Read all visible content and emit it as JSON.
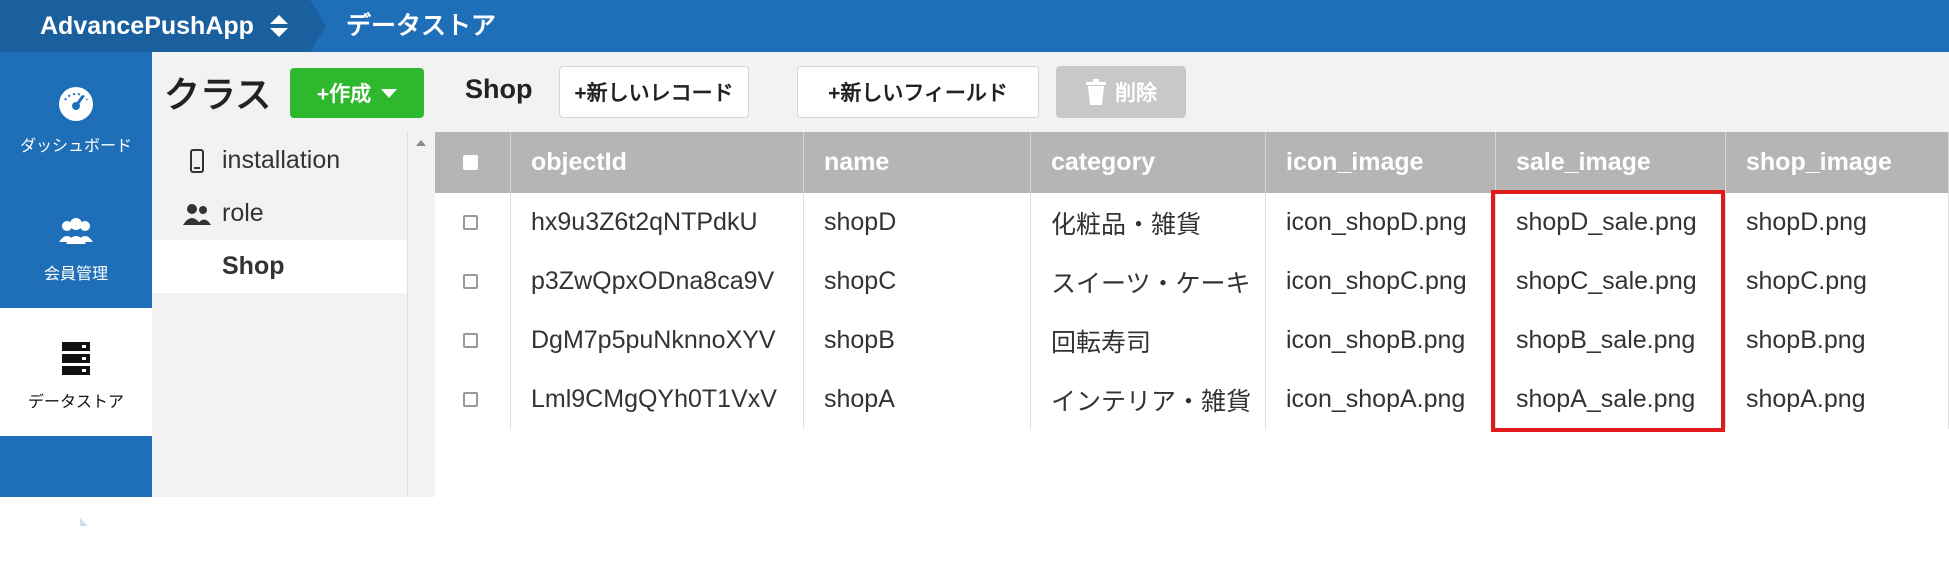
{
  "topbar": {
    "app_name": "AdvancePushApp",
    "breadcrumb": "データストア"
  },
  "nav": {
    "items": [
      {
        "label": "ダッシュボード",
        "icon": "gauge-icon"
      },
      {
        "label": "会員管理",
        "icon": "users-icon"
      },
      {
        "label": "データストア",
        "icon": "database-icon"
      },
      {
        "label": "",
        "icon": "file-icon"
      }
    ],
    "active": "データストア"
  },
  "classes": {
    "title": "クラス",
    "create_label": "+作成",
    "items": [
      {
        "label": "installation",
        "icon": "mobile-icon"
      },
      {
        "label": "role",
        "icon": "users-icon"
      },
      {
        "label": "Shop",
        "icon": ""
      }
    ],
    "selected": "Shop"
  },
  "toolbar": {
    "class_name": "Shop",
    "new_record_label": "+新しいレコード",
    "new_field_label": "+新しいフィールド",
    "delete_label": "削除"
  },
  "table": {
    "columns": [
      "objectId",
      "name",
      "category",
      "icon_image",
      "sale_image",
      "shop_image"
    ],
    "rows": [
      [
        "hx9u3Z6t2qNTPdkU",
        "shopD",
        "化粧品・雑貨",
        "icon_shopD.png",
        "shopD_sale.png",
        "shopD.png"
      ],
      [
        "p3ZwQpxODna8ca9V",
        "shopC",
        "スイーツ・ケーキ",
        "icon_shopC.png",
        "shopC_sale.png",
        "shopC.png"
      ],
      [
        "DgM7p5puNknnoXYV",
        "shopB",
        "回転寿司",
        "icon_shopB.png",
        "shopB_sale.png",
        "shopB.png"
      ],
      [
        "Lml9CMgQYh0T1VxV",
        "shopA",
        "インテリア・雑貨",
        "icon_shopA.png",
        "shopA_sale.png",
        "shopA.png"
      ]
    ],
    "highlighted_column": "sale_image"
  },
  "colors": {
    "primary": "#1e6fb8",
    "primary_dark": "#1a5f9e",
    "create_green": "#2db82d",
    "header_gray": "#b5b5b5",
    "highlight_red": "#e01a1a"
  }
}
